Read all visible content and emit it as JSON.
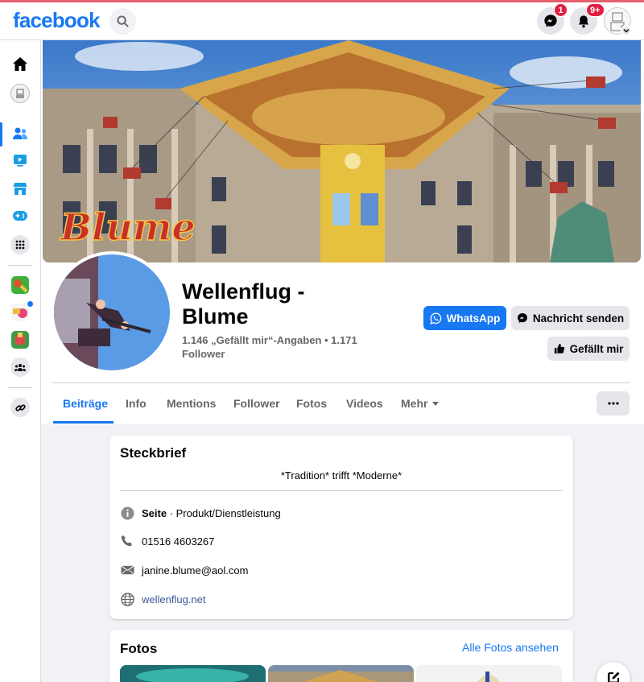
{
  "topbar": {
    "logo": "facebook",
    "messenger_badge": "1",
    "notifications_badge": "9+"
  },
  "profile": {
    "name": "Wellenflug - Blume",
    "stats": "1.146 „Gefällt mir“-Angaben • 1.171 Follower",
    "whatsapp_button": "WhatsApp",
    "message_button": "Nachricht senden",
    "like_button": "Gefällt mir"
  },
  "tabs": [
    "Beiträge",
    "Info",
    "Mentions",
    "Follower",
    "Fotos",
    "Videos",
    "Mehr"
  ],
  "intro": {
    "title": "Steckbrief",
    "bio": "*Tradition* trifft *Moderne*",
    "category_label": "Seite",
    "category_value": " · Produkt/Dienstleistung",
    "phone": "01516 4603267",
    "email": "janine.blume@aol.com",
    "website": "wellenflug.net"
  },
  "photos": {
    "title": "Fotos",
    "see_all": "Alle Fotos ansehen"
  },
  "colors": {
    "brand": "#1877f2",
    "badge": "#e41e3f",
    "background": "#f0f2f5"
  }
}
